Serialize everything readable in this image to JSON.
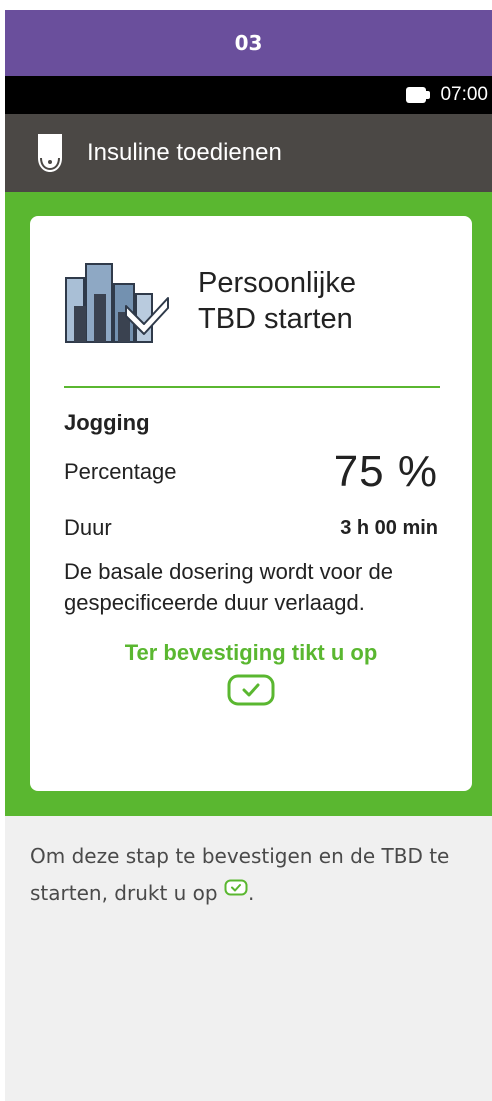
{
  "step": {
    "number": "03"
  },
  "status_bar": {
    "time": "07:00",
    "battery_icon": "battery-icon"
  },
  "title_bar": {
    "title": "Insuline toedienen",
    "icon": "insulin-pump-icon"
  },
  "card": {
    "heading_line1": "Persoonlijke",
    "heading_line2": "TBD starten",
    "icon": "tbd-chart-icon",
    "profile_name": "Jogging",
    "percentage_label": "Percentage",
    "percentage_value": "75 %",
    "duration_label": "Duur",
    "duration_value": "3 h 00 min",
    "description": "De basale dosering wordt voor de gespecificeerde duur verlaagd.",
    "confirm_prompt": "Ter bevestiging tikt u op",
    "confirm_icon": "check-button-icon"
  },
  "instruction": {
    "text": "Om deze stap te bevestigen en de TBD te starten, drukt u op",
    "end": "."
  },
  "colors": {
    "header_purple": "#6a4f9c",
    "title_bar": "#4b4845",
    "accent_green": "#5ab730",
    "page_bg": "#f0f0f0"
  }
}
